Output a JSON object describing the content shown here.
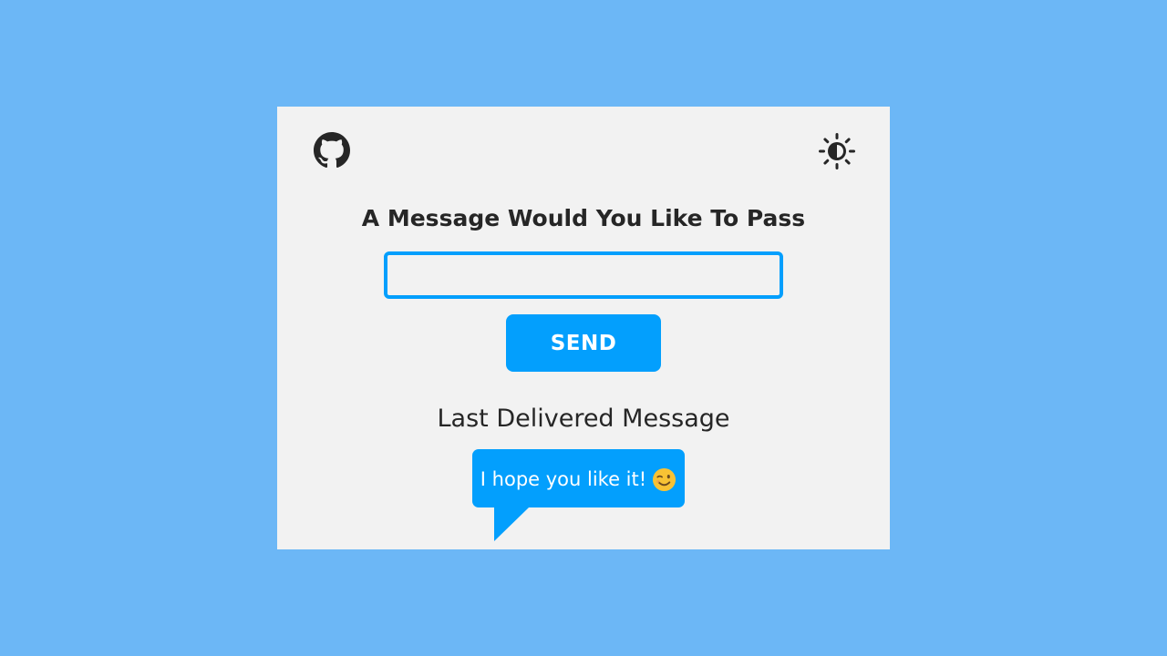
{
  "app": {
    "heading": "A Message Would You Like To Pass",
    "input": {
      "value": "",
      "placeholder": ""
    },
    "send_label": "SEND",
    "last_label": "Last Delivered Message",
    "last_message": "I hope you like it!",
    "icons": {
      "github": "github-icon",
      "theme_toggle": "brightness-icon",
      "emoji": "winking-smile-emoji"
    }
  },
  "colors": {
    "background": "#6cb7f6",
    "card": "#f2f2f2",
    "accent": "#039ffd",
    "text": "#262626",
    "icon": "#262626",
    "emoji": "#f8c234"
  }
}
